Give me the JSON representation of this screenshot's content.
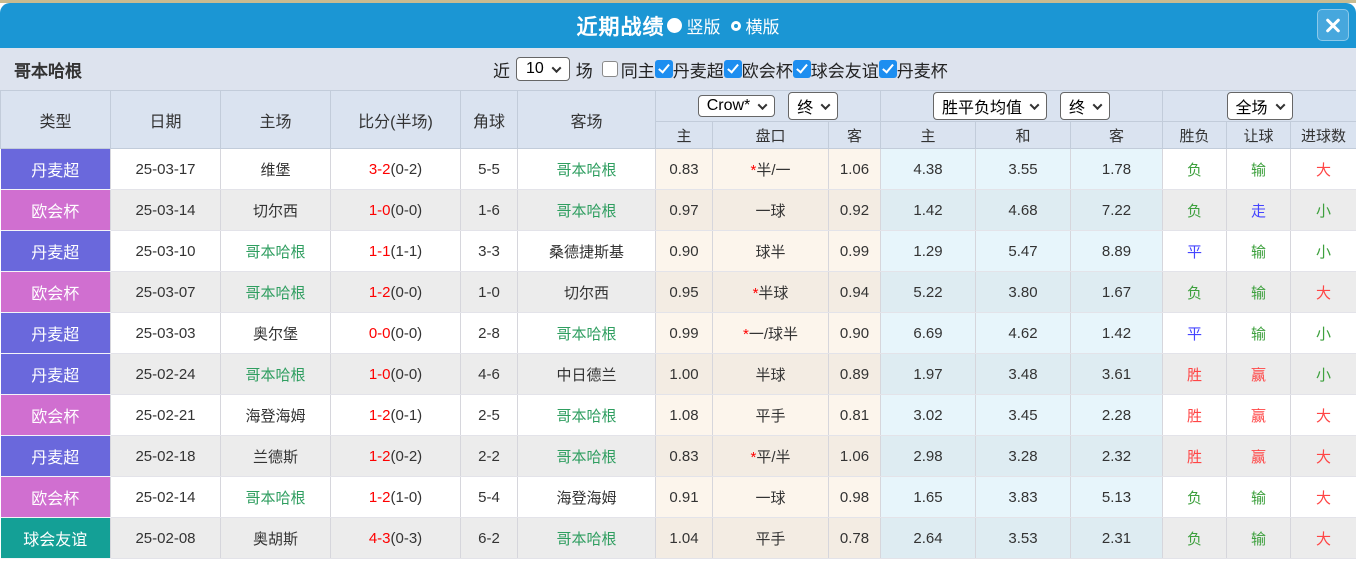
{
  "titlebar": {
    "title": "近期战绩",
    "radio_vertical": "竖版",
    "radio_horizontal": "横版"
  },
  "filter": {
    "team": "哥本哈根",
    "recent_label": "近",
    "count_value": "10",
    "games_label": "场",
    "same_home_label": "同主",
    "leagues": [
      {
        "label": "丹麦超",
        "checked": true
      },
      {
        "label": "欧会杯",
        "checked": true
      },
      {
        "label": "球会友谊",
        "checked": true
      },
      {
        "label": "丹麦杯",
        "checked": true
      }
    ]
  },
  "table": {
    "dropdowns": {
      "company": "Crow*",
      "company_time": "终",
      "avg": "胜平负均值",
      "avg_time": "终",
      "scope": "全场"
    },
    "headers": {
      "type": "类型",
      "date": "日期",
      "home": "主场",
      "score": "比分(半场)",
      "corner": "角球",
      "away": "客场",
      "odds_home": "主",
      "odds_line": "盘口",
      "odds_away": "客",
      "avg_home": "主",
      "avg_draw": "和",
      "avg_away": "客",
      "result": "胜负",
      "handicap": "让球",
      "goals": "进球数"
    },
    "rows": [
      {
        "league": "丹麦超",
        "league_color": "danish_super",
        "date": "25-03-17",
        "home": "维堡",
        "home_is_subject": false,
        "score": "3-2",
        "half": "(0-2)",
        "corner": "5-5",
        "away": "哥本哈根",
        "away_is_subject": true,
        "odds_home": "0.83",
        "line_star": true,
        "line": "半/一",
        "odds_away": "1.06",
        "avg": [
          "4.38",
          "3.55",
          "1.78"
        ],
        "result": {
          "text": "负",
          "color": "green"
        },
        "handicap": {
          "text": "输",
          "color": "green"
        },
        "goals": {
          "text": "大",
          "color": "red"
        }
      },
      {
        "league": "欧会杯",
        "league_color": "conference",
        "date": "25-03-14",
        "home": "切尔西",
        "home_is_subject": false,
        "score": "1-0",
        "half": "(0-0)",
        "corner": "1-6",
        "away": "哥本哈根",
        "away_is_subject": true,
        "odds_home": "0.97",
        "line_star": false,
        "line": "一球",
        "odds_away": "0.92",
        "avg": [
          "1.42",
          "4.68",
          "7.22"
        ],
        "result": {
          "text": "负",
          "color": "green"
        },
        "handicap": {
          "text": "走",
          "color": "blue"
        },
        "goals": {
          "text": "小",
          "color": "green"
        }
      },
      {
        "league": "丹麦超",
        "league_color": "danish_super",
        "date": "25-03-10",
        "home": "哥本哈根",
        "home_is_subject": true,
        "score": "1-1",
        "half": "(1-1)",
        "corner": "3-3",
        "away": "桑德捷斯基",
        "away_is_subject": false,
        "odds_home": "0.90",
        "line_star": false,
        "line": "球半",
        "odds_away": "0.99",
        "avg": [
          "1.29",
          "5.47",
          "8.89"
        ],
        "result": {
          "text": "平",
          "color": "blue"
        },
        "handicap": {
          "text": "输",
          "color": "green"
        },
        "goals": {
          "text": "小",
          "color": "green"
        }
      },
      {
        "league": "欧会杯",
        "league_color": "conference",
        "date": "25-03-07",
        "home": "哥本哈根",
        "home_is_subject": true,
        "score": "1-2",
        "half": "(0-0)",
        "corner": "1-0",
        "away": "切尔西",
        "away_is_subject": false,
        "odds_home": "0.95",
        "line_star": true,
        "line": "半球",
        "odds_away": "0.94",
        "avg": [
          "5.22",
          "3.80",
          "1.67"
        ],
        "result": {
          "text": "负",
          "color": "green"
        },
        "handicap": {
          "text": "输",
          "color": "green"
        },
        "goals": {
          "text": "大",
          "color": "red"
        }
      },
      {
        "league": "丹麦超",
        "league_color": "danish_super",
        "date": "25-03-03",
        "home": "奥尔堡",
        "home_is_subject": false,
        "score": "0-0",
        "half": "(0-0)",
        "corner": "2-8",
        "away": "哥本哈根",
        "away_is_subject": true,
        "odds_home": "0.99",
        "line_star": true,
        "line": "一/球半",
        "odds_away": "0.90",
        "avg": [
          "6.69",
          "4.62",
          "1.42"
        ],
        "result": {
          "text": "平",
          "color": "blue"
        },
        "handicap": {
          "text": "输",
          "color": "green"
        },
        "goals": {
          "text": "小",
          "color": "green"
        }
      },
      {
        "league": "丹麦超",
        "league_color": "danish_super",
        "date": "25-02-24",
        "home": "哥本哈根",
        "home_is_subject": true,
        "score": "1-0",
        "half": "(0-0)",
        "corner": "4-6",
        "away": "中日德兰",
        "away_is_subject": false,
        "odds_home": "1.00",
        "line_star": false,
        "line": "半球",
        "odds_away": "0.89",
        "avg": [
          "1.97",
          "3.48",
          "3.61"
        ],
        "result": {
          "text": "胜",
          "color": "red"
        },
        "handicap": {
          "text": "赢",
          "color": "red"
        },
        "goals": {
          "text": "小",
          "color": "green"
        }
      },
      {
        "league": "欧会杯",
        "league_color": "conference",
        "date": "25-02-21",
        "home": "海登海姆",
        "home_is_subject": false,
        "score": "1-2",
        "half": "(0-1)",
        "corner": "2-5",
        "away": "哥本哈根",
        "away_is_subject": true,
        "odds_home": "1.08",
        "line_star": false,
        "line": "平手",
        "odds_away": "0.81",
        "avg": [
          "3.02",
          "3.45",
          "2.28"
        ],
        "result": {
          "text": "胜",
          "color": "red"
        },
        "handicap": {
          "text": "赢",
          "color": "red"
        },
        "goals": {
          "text": "大",
          "color": "red"
        }
      },
      {
        "league": "丹麦超",
        "league_color": "danish_super",
        "date": "25-02-18",
        "home": "兰德斯",
        "home_is_subject": false,
        "score": "1-2",
        "half": "(0-2)",
        "corner": "2-2",
        "away": "哥本哈根",
        "away_is_subject": true,
        "odds_home": "0.83",
        "line_star": true,
        "line": "平/半",
        "odds_away": "1.06",
        "avg": [
          "2.98",
          "3.28",
          "2.32"
        ],
        "result": {
          "text": "胜",
          "color": "red"
        },
        "handicap": {
          "text": "赢",
          "color": "red"
        },
        "goals": {
          "text": "大",
          "color": "red"
        }
      },
      {
        "league": "欧会杯",
        "league_color": "conference",
        "date": "25-02-14",
        "home": "哥本哈根",
        "home_is_subject": true,
        "score": "1-2",
        "half": "(1-0)",
        "corner": "5-4",
        "away": "海登海姆",
        "away_is_subject": false,
        "odds_home": "0.91",
        "line_star": false,
        "line": "一球",
        "odds_away": "0.98",
        "avg": [
          "1.65",
          "3.83",
          "5.13"
        ],
        "result": {
          "text": "负",
          "color": "green"
        },
        "handicap": {
          "text": "输",
          "color": "green"
        },
        "goals": {
          "text": "大",
          "color": "red"
        }
      },
      {
        "league": "球会友谊",
        "league_color": "friendly",
        "date": "25-02-08",
        "home": "奥胡斯",
        "home_is_subject": false,
        "score": "4-3",
        "half": "(0-3)",
        "corner": "6-2",
        "away": "哥本哈根",
        "away_is_subject": true,
        "odds_home": "1.04",
        "line_star": false,
        "line": "平手",
        "odds_away": "0.78",
        "avg": [
          "2.64",
          "3.53",
          "2.31"
        ],
        "result": {
          "text": "负",
          "color": "green"
        },
        "handicap": {
          "text": "输",
          "color": "green"
        },
        "goals": {
          "text": "大",
          "color": "red"
        }
      }
    ]
  },
  "colors": {
    "accent_blue": "#1b96d4",
    "top_strip": "#c8bb91",
    "filter_bg": "#dde3ee",
    "header_bg": "#dae3f0",
    "checkbox_blue": "#1d8ef0",
    "odds_column_bg": "#f9ecdc",
    "avg_column_bg": "#ddeef7",
    "team_green": "#2f9e60",
    "score_red": "#fe0000",
    "league": {
      "danish_super": "#6a68dc",
      "conference": "#d06fd0",
      "friendly": "#14a096"
    },
    "status": {
      "red": "#ff4545",
      "blue": "#4545ff",
      "green": "#3da03d"
    }
  }
}
